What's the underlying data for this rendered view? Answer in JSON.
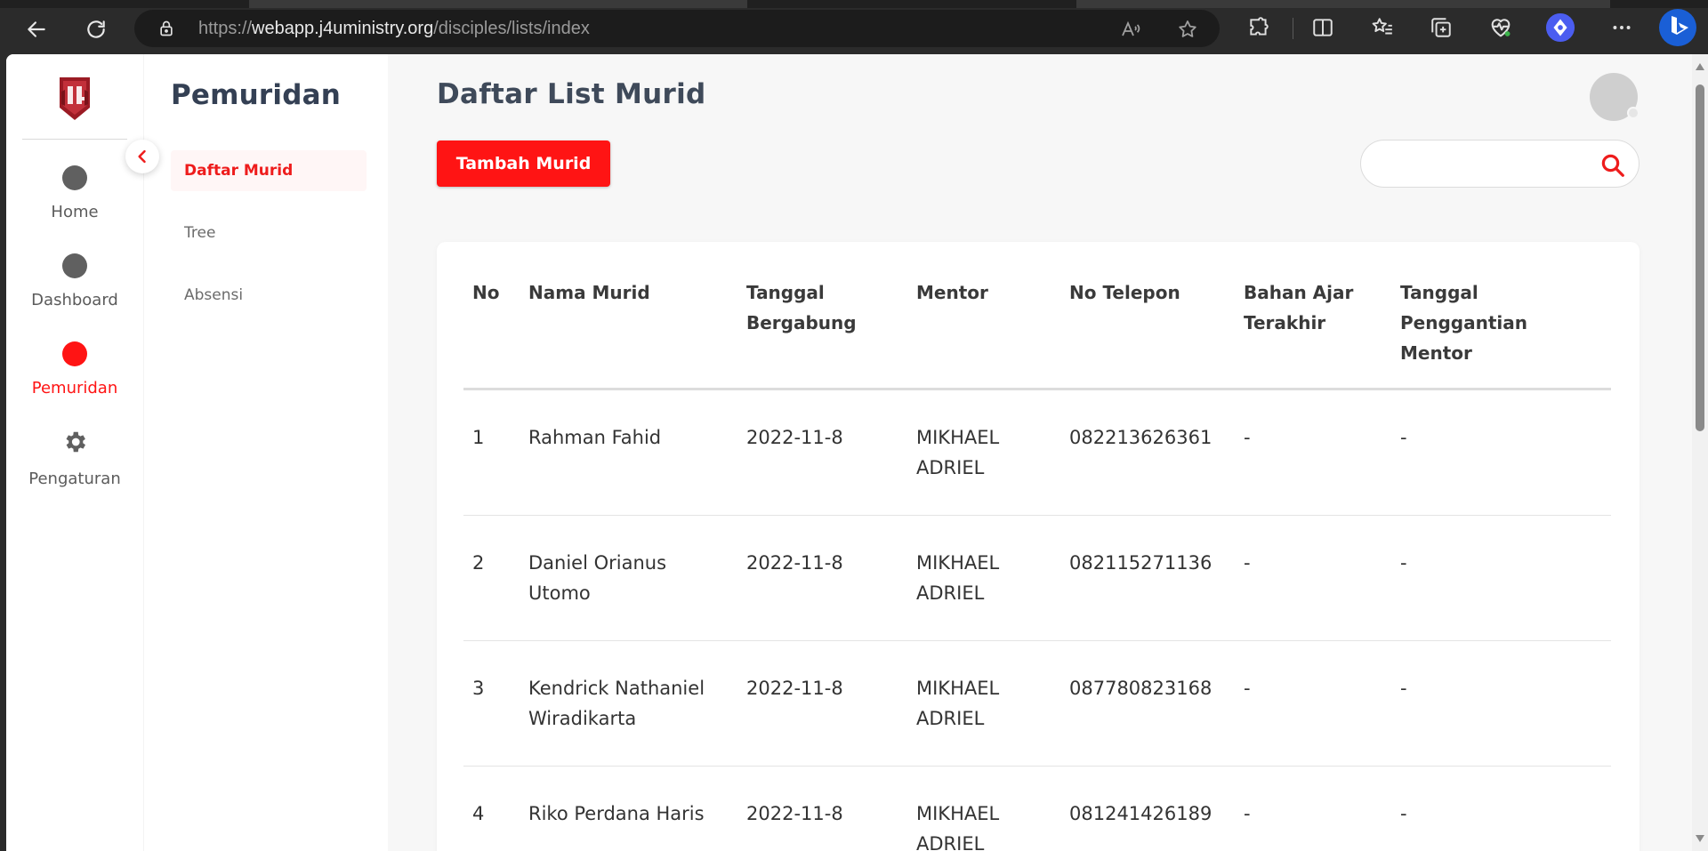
{
  "browser": {
    "url_scheme": "https://",
    "url_host": "webapp.j4uministry.org",
    "url_path": "/disciples/lists/index"
  },
  "rail": {
    "items": [
      {
        "label": "Home",
        "active": false
      },
      {
        "label": "Dashboard",
        "active": false
      },
      {
        "label": "Pemuridan",
        "active": true
      },
      {
        "label": "Pengaturan",
        "active": false
      }
    ]
  },
  "subnav": {
    "title": "Pemuridan",
    "items": [
      {
        "label": "Daftar Murid",
        "active": true
      },
      {
        "label": "Tree",
        "active": false
      },
      {
        "label": "Absensi",
        "active": false
      }
    ]
  },
  "main": {
    "title": "Daftar List Murid",
    "add_button": "Tambah Murid",
    "search_value": ""
  },
  "table": {
    "headers": {
      "no": "No",
      "nama": "Nama Murid",
      "tanggal": "Tanggal Bergabung",
      "mentor": "Mentor",
      "telepon": "No Telepon",
      "bahan": "Bahan Ajar Terakhir",
      "penggantian": "Tanggal Penggantian Mentor"
    },
    "rows": [
      {
        "no": "1",
        "nama": "Rahman Fahid",
        "tanggal": "2022-11-8",
        "mentor": "MIKHAEL ADRIEL",
        "telepon": "082213626361",
        "bahan": "-",
        "penggantian": "-"
      },
      {
        "no": "2",
        "nama": "Daniel Orianus Utomo",
        "tanggal": "2022-11-8",
        "mentor": "MIKHAEL ADRIEL",
        "telepon": "082115271136",
        "bahan": "-",
        "penggantian": "-"
      },
      {
        "no": "3",
        "nama": "Kendrick Nathaniel Wiradikarta",
        "tanggal": "2022-11-8",
        "mentor": "MIKHAEL ADRIEL",
        "telepon": "087780823168",
        "bahan": "-",
        "penggantian": "-"
      },
      {
        "no": "4",
        "nama": "Riko Perdana Haris",
        "tanggal": "2022-11-8",
        "mentor": "MIKHAEL ADRIEL",
        "telepon": "081241426189",
        "bahan": "-",
        "penggantian": "-"
      }
    ]
  },
  "colors": {
    "accent": "#ff1414",
    "heading": "#344054",
    "browser_bg": "#2b2b2b"
  }
}
